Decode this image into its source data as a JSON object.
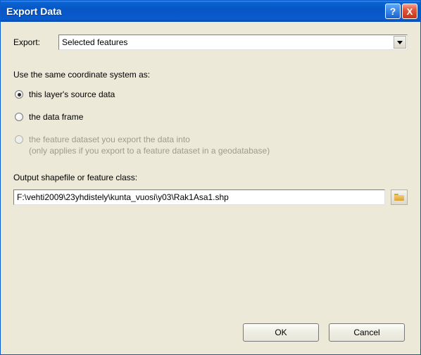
{
  "titlebar": {
    "title": "Export Data",
    "help_glyph": "?",
    "close_glyph": "X"
  },
  "export": {
    "label": "Export:",
    "selected": "Selected features"
  },
  "coord_section": {
    "label": "Use the same coordinate system as:",
    "options": {
      "source": "this layer's source data",
      "frame": "the data frame",
      "dataset": "the feature dataset you export the data into",
      "dataset_note": "(only applies if you export to a feature dataset in a geodatabase)"
    },
    "selected_key": "source"
  },
  "output": {
    "label": "Output shapefile or feature class:",
    "value": "F:\\vehti2009\\23yhdistely\\kunta_vuosi\\y03\\Rak1Asa1.shp"
  },
  "buttons": {
    "ok": "OK",
    "cancel": "Cancel"
  }
}
